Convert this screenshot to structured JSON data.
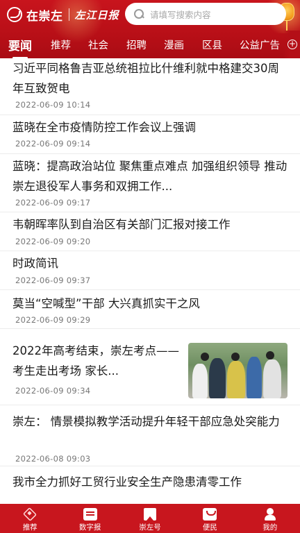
{
  "header": {
    "app_name": "在崇左",
    "paper_name": "左江日报",
    "search_placeholder": "请填写搜索内容"
  },
  "tabs": [
    "要闻",
    "推荐",
    "社会",
    "招聘",
    "漫画",
    "区县",
    "公益广告"
  ],
  "news": [
    {
      "title": "习近平同格鲁吉亚总统祖拉比什维利就中格建交30周年互致贺电",
      "time": "2022-06-09 10:14"
    },
    {
      "title": "蓝晓在全市疫情防控工作会议上强调",
      "time": "2022-06-09 09:14"
    },
    {
      "title": "蓝晓：提高政治站位 聚焦重点难点 加强组织领导  推动崇左退役军人事务和双拥工作...",
      "time": "2022-06-09 09:17"
    },
    {
      "title": "韦朝晖率队到自治区有关部门汇报对接工作",
      "time": "2022-06-09 09:20"
    },
    {
      "title": "时政简讯",
      "time": "2022-06-09 09:37"
    },
    {
      "title": "莫当“空喊型”干部 大兴真抓实干之风",
      "time": "2022-06-09 09:29"
    },
    {
      "title": "2022年高考结束，崇左考点—— 考生走出考场 家长...",
      "time": "2022-06-09 09:34"
    },
    {
      "title": "崇左：  情景模拟教学活动提升年轻干部应急处突能力",
      "time": "2022-06-08 09:03"
    },
    {
      "title": "我市全力抓好工贸行业安全生产隐患清零工作",
      "time": ""
    }
  ],
  "bottom_nav": [
    "推荐",
    "数字报",
    "崇左号",
    "便民",
    "我的"
  ],
  "colors": {
    "brand_red": "#c8161e"
  }
}
